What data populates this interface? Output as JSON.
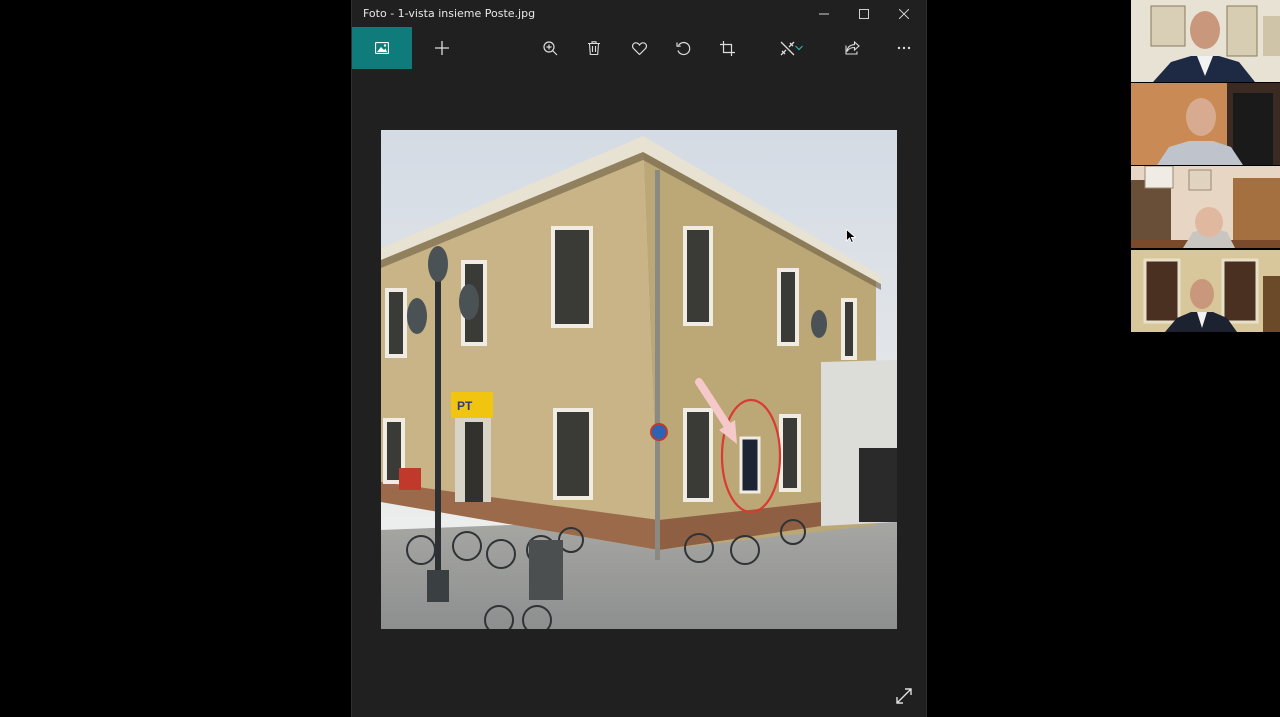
{
  "window": {
    "title": "Foto - 1-vista insieme Poste.jpg"
  },
  "toolbar": {
    "items": [
      {
        "name": "collection-icon"
      },
      {
        "name": "add-icon"
      },
      {
        "name": "zoom-in-icon"
      },
      {
        "name": "delete-icon"
      },
      {
        "name": "favorite-icon"
      },
      {
        "name": "rotate-icon"
      },
      {
        "name": "crop-icon"
      },
      {
        "name": "edit-icon"
      },
      {
        "name": "share-icon"
      },
      {
        "name": "more-icon"
      }
    ],
    "accent_color": "#0f7b7b"
  },
  "photo": {
    "sign_text": "PT"
  },
  "video_call": {
    "participants": 4
  }
}
